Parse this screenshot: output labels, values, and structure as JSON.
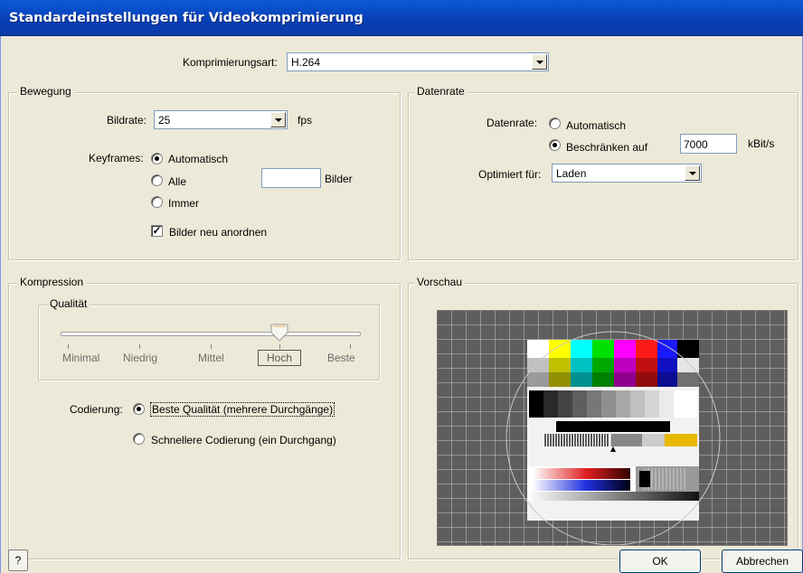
{
  "window": {
    "title": "Standardeinstellungen für Videokomprimierung"
  },
  "compression_type": {
    "label": "Komprimierungsart:",
    "value": "H.264"
  },
  "motion": {
    "group_title": "Bewegung",
    "framerate_label": "Bildrate:",
    "framerate_value": "25",
    "framerate_unit": "fps",
    "keyframes_label": "Keyframes:",
    "keyframes_options": [
      "Automatisch",
      "Alle",
      "Immer"
    ],
    "keyframes_selected": "Automatisch",
    "keyframes_interval_value": "",
    "keyframes_interval_unit": "Bilder",
    "reorder_label": "Bilder neu anordnen",
    "reorder_checked": true
  },
  "datarate": {
    "group_title": "Datenrate",
    "label": "Datenrate:",
    "option_auto": "Automatisch",
    "option_limit": "Beschränken auf",
    "selected": "Beschränken auf",
    "limit_value": "7000",
    "limit_unit": "kBit/s",
    "optimize_label": "Optimiert für:",
    "optimize_value": "Laden"
  },
  "compression": {
    "group_title": "Kompression",
    "quality_group_title": "Qualität",
    "quality_levels": [
      "Minimal",
      "Niedrig",
      "Mittel",
      "Hoch",
      "Beste"
    ],
    "quality_selected": "Hoch",
    "quality_fraction": 0.75,
    "encoding_label": "Codierung:",
    "encoding_best": "Beste Qualität (mehrere Durchgänge)",
    "encoding_fast": "Schnellere Codierung (ein Durchgang)",
    "encoding_selected": "Beste Qualität (mehrere Durchgänge)"
  },
  "preview": {
    "group_title": "Vorschau"
  },
  "buttons": {
    "help": "?",
    "ok": "OK",
    "cancel": "Abbrechen"
  },
  "colors": {
    "title_bar": "#0a46c4",
    "dialog_bg": "#ece9d8",
    "field_border": "#7f9db9"
  }
}
